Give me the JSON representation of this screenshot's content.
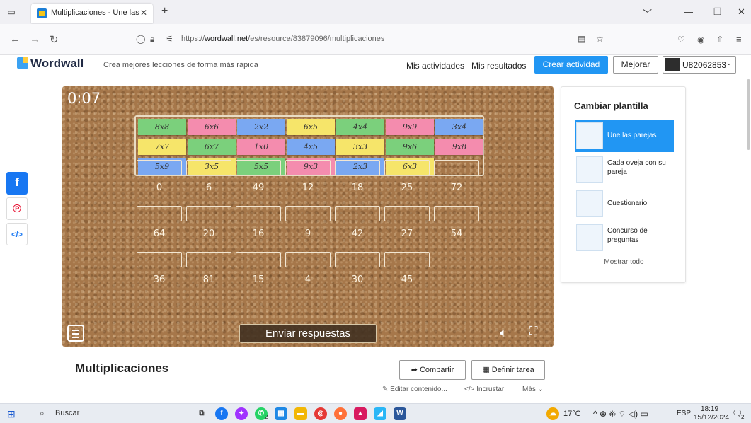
{
  "browser": {
    "tab_title": "Multiplicaciones - Une las parej",
    "tab_close": "✕",
    "new_tab": "+",
    "url_prefix": "https://",
    "url_domain": "wordwall.net",
    "url_path": "/es/resource/83879096/multiplicaciones"
  },
  "header": {
    "logo_text": "Wordwall",
    "tagline": "Crea mejores lecciones de forma más rápida",
    "mis_actividades": "Mis actividades",
    "mis_resultados": "Mis resultados",
    "crear_actividad": "Crear actividad",
    "mejorar": "Mejorar",
    "user": "U82062853"
  },
  "game": {
    "timer": "0:07",
    "cards": [
      {
        "label": "8x8",
        "color": "#7bd07c"
      },
      {
        "label": "6x6",
        "color": "#f48cae"
      },
      {
        "label": "2x2",
        "color": "#7aa8f2"
      },
      {
        "label": "6x5",
        "color": "#f6e56a"
      },
      {
        "label": "4x4",
        "color": "#7bd07c"
      },
      {
        "label": "9x9",
        "color": "#f48cae"
      },
      {
        "label": "3x4",
        "color": "#7aa8f2"
      },
      {
        "label": "7x7",
        "color": "#f6e56a"
      },
      {
        "label": "6x7",
        "color": "#7bd07c"
      },
      {
        "label": "1x0",
        "color": "#f48cae"
      },
      {
        "label": "4x5",
        "color": "#7aa8f2"
      },
      {
        "label": "3x3",
        "color": "#f6e56a"
      },
      {
        "label": "9x6",
        "color": "#7bd07c"
      },
      {
        "label": "9x8",
        "color": "#f48cae"
      },
      {
        "label": "5x9",
        "color": "#7aa8f2"
      },
      {
        "label": "3x5",
        "color": "#f6e56a"
      },
      {
        "label": "5x5",
        "color": "#7bd07c"
      },
      {
        "label": "9x3",
        "color": "#f48cae"
      },
      {
        "label": "2x3",
        "color": "#7aa8f2"
      },
      {
        "label": "6x3",
        "color": "#f6e56a"
      }
    ],
    "answer_rows": [
      [
        "0",
        "6",
        "49",
        "12",
        "18",
        "25",
        "72"
      ],
      [
        "64",
        "20",
        "16",
        "9",
        "42",
        "27",
        "54"
      ],
      [
        "36",
        "81",
        "15",
        "4",
        "30",
        "45"
      ]
    ],
    "submit_label": "Enviar respuestas"
  },
  "panel": {
    "title": "Cambiar plantilla",
    "templates": [
      {
        "label": "Une las parejas",
        "active": true
      },
      {
        "label": "Cada oveja con su pareja",
        "active": false
      },
      {
        "label": "Cuestionario",
        "active": false
      },
      {
        "label": "Concurso de preguntas",
        "active": false
      }
    ],
    "show_all": "Mostrar todo"
  },
  "activity": {
    "title": "Multiplicaciones",
    "compartir": "Compartir",
    "definir_tarea": "Definir tarea",
    "editar": "Editar contenido...",
    "incrustar": "Incrustar",
    "mas": "Más"
  },
  "taskbar": {
    "search_placeholder": "Buscar",
    "weather": "17°C",
    "lang": "ESP",
    "time": "18:19",
    "date": "15/12/2024",
    "notification_count": "2",
    "whatsapp_badge": "2"
  },
  "colors": {
    "accent": "#2196f3",
    "cork": "#a6774a"
  }
}
